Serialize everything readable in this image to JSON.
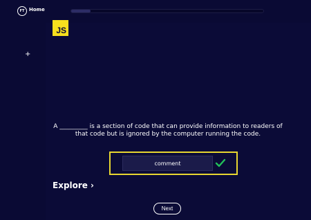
{
  "header": {
    "logo_text": "FT",
    "home_label": "Home",
    "progress": 0.1
  },
  "sidebar": {
    "add_label": "+"
  },
  "lesson": {
    "language_badge": "JS",
    "question": "A _________ is a section of code that can provide information to readers of that code but is ignored by the computer running the code.",
    "answer_value": "comment",
    "answer_status": "correct",
    "check_icon": "check-icon",
    "explore_label": "Explore",
    "explore_chevron": "›",
    "next_label": "Next"
  },
  "colors": {
    "background": "#0a0a34",
    "highlight_border": "#e8d630",
    "badge": "#f7df1e",
    "check": "#23c05a"
  }
}
